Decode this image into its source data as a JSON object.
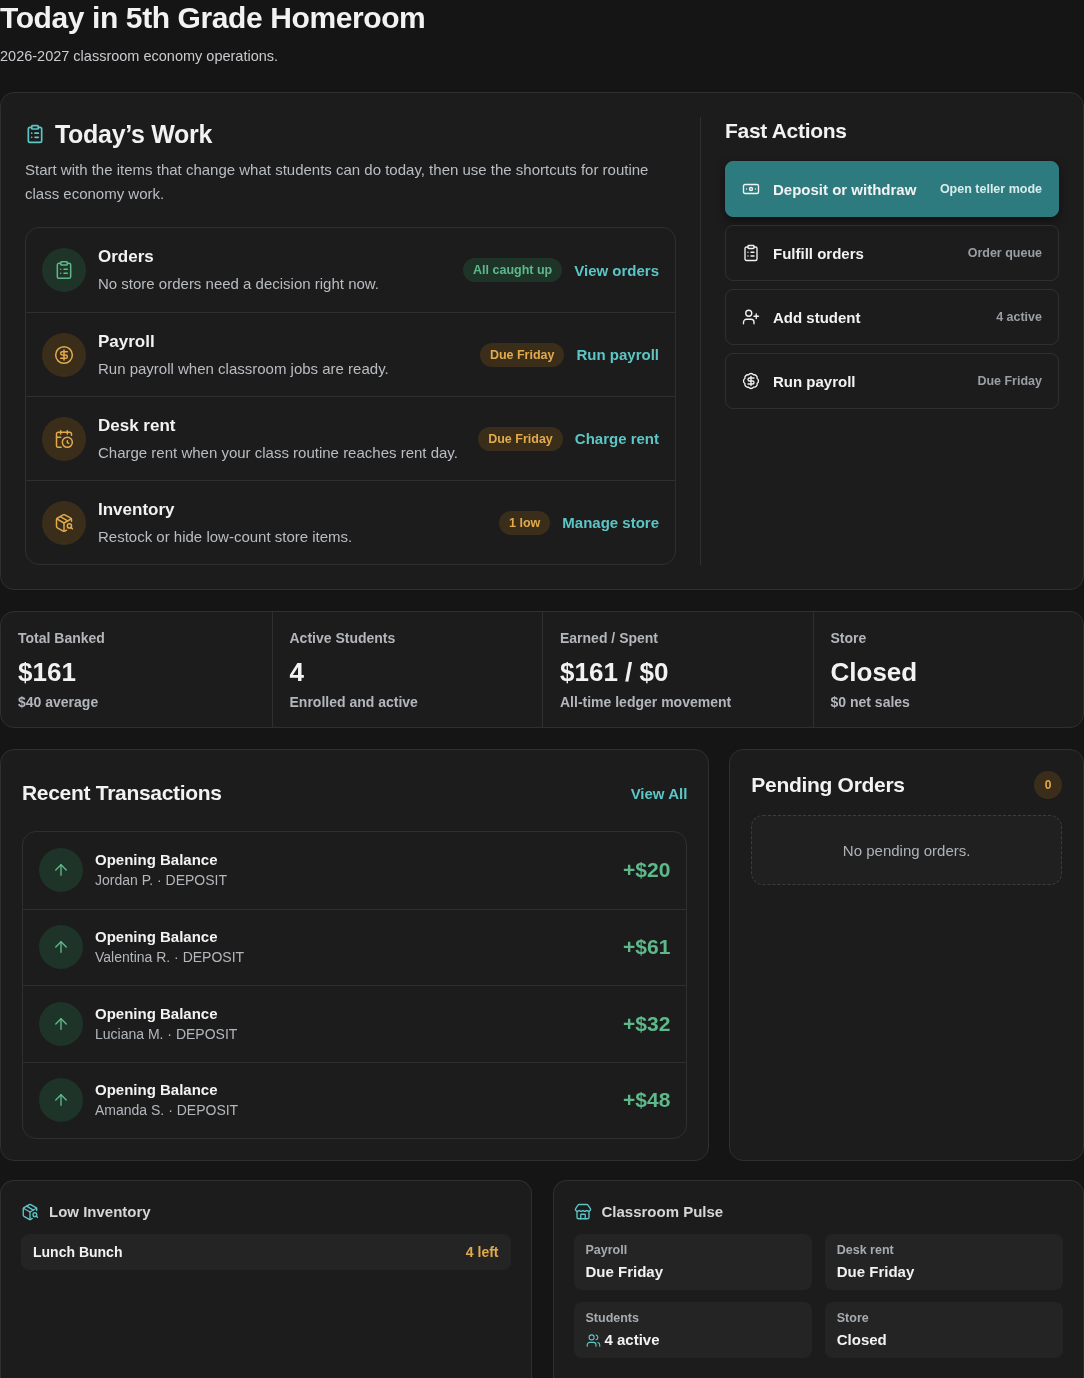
{
  "header": {
    "title": "Today in 5th Grade Homeroom",
    "subtitle": "2026-2027 classroom economy operations."
  },
  "todays_work": {
    "title": "Today’s Work",
    "description": "Start with the items that change what students can do today, then use the shortcuts for routine class economy work.",
    "tasks": [
      {
        "kind": "orders",
        "title": "Orders",
        "description": "No store orders need a decision right now.",
        "badge": "All caught up",
        "needs_attention": false,
        "action": "View orders"
      },
      {
        "kind": "payroll",
        "title": "Payroll",
        "description": "Run payroll when classroom jobs are ready.",
        "badge": "Due Friday",
        "needs_attention": true,
        "action": "Run payroll"
      },
      {
        "kind": "rent",
        "title": "Desk rent",
        "description": "Charge rent when your class routine reaches rent day.",
        "badge": "Due Friday",
        "needs_attention": true,
        "action": "Charge rent"
      },
      {
        "kind": "inventory",
        "title": "Inventory",
        "description": "Restock or hide low-count store items.",
        "badge": "1 low",
        "needs_attention": true,
        "action": "Manage store"
      }
    ]
  },
  "fast_actions": {
    "title": "Fast Actions",
    "items": [
      {
        "kind": "deposit",
        "label": "Deposit or withdraw",
        "hint": "Open teller mode",
        "primary": true
      },
      {
        "kind": "orders",
        "label": "Fulfill orders",
        "hint": "Order queue",
        "primary": false
      },
      {
        "kind": "student",
        "label": "Add student",
        "hint": "4 active",
        "primary": false
      },
      {
        "kind": "payroll",
        "label": "Run payroll",
        "hint": "Due Friday",
        "primary": false
      }
    ]
  },
  "stats": [
    {
      "label": "Total Banked",
      "value": "$161",
      "note": "$40 average"
    },
    {
      "label": "Active Students",
      "value": "4",
      "note": "Enrolled and active"
    },
    {
      "label": "Earned / Spent",
      "value": "$161 / $0",
      "note": "All-time ledger movement"
    },
    {
      "label": "Store",
      "value": "Closed",
      "note": "$0 net sales"
    }
  ],
  "recent_transactions": {
    "title": "Recent Transactions",
    "link": "View All",
    "rows": [
      {
        "kind": "deposit",
        "title": "Opening Balance",
        "detail": "Jordan P. · DEPOSIT",
        "amount": "+$20"
      },
      {
        "kind": "deposit",
        "title": "Opening Balance",
        "detail": "Valentina R. · DEPOSIT",
        "amount": "+$61"
      },
      {
        "kind": "deposit",
        "title": "Opening Balance",
        "detail": "Luciana M. · DEPOSIT",
        "amount": "+$32"
      },
      {
        "kind": "deposit",
        "title": "Opening Balance",
        "detail": "Amanda S. · DEPOSIT",
        "amount": "+$48"
      }
    ]
  },
  "pending_orders": {
    "title": "Pending Orders",
    "count": "0",
    "empty_message": "No pending orders."
  },
  "low_inventory": {
    "title": "Low Inventory",
    "items": [
      {
        "name": "Lunch Bunch",
        "stock": "4 left"
      }
    ]
  },
  "classroom_pulse": {
    "title": "Classroom Pulse",
    "tiles": [
      {
        "kind": "plain",
        "label": "Payroll",
        "value": "Due Friday"
      },
      {
        "kind": "plain",
        "label": "Desk rent",
        "value": "Due Friday"
      },
      {
        "kind": "people",
        "label": "Students",
        "value": "4 active"
      },
      {
        "kind": "plain",
        "label": "Store",
        "value": "Closed"
      }
    ]
  }
}
